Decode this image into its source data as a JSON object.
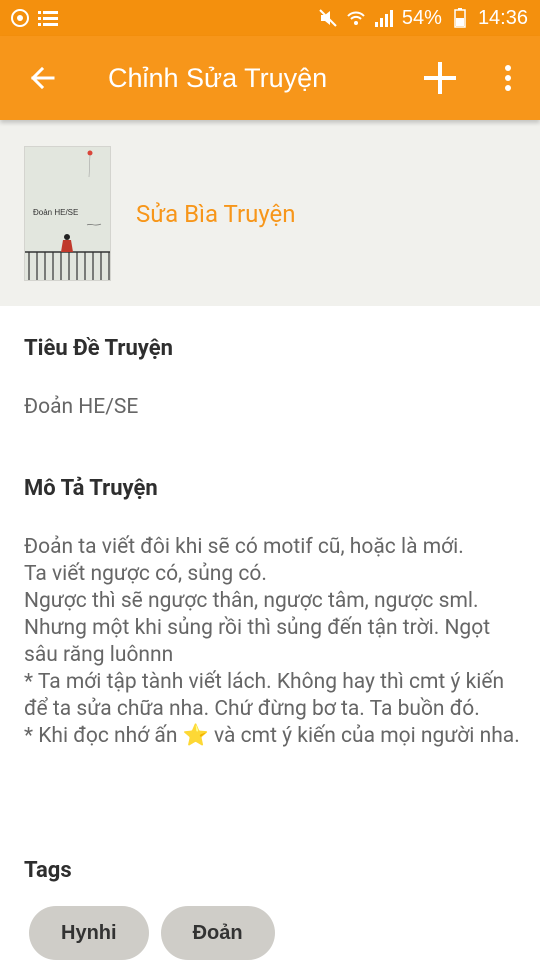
{
  "status_bar": {
    "battery_percent": "54%",
    "time": "14:36",
    "icons": [
      "app-notification-icon",
      "list-icon",
      "mute-icon",
      "wifi-icon",
      "signal-icon",
      "battery-icon"
    ]
  },
  "app_bar": {
    "title": "Chỉnh Sửa Truyện",
    "icons": [
      "back-arrow-icon",
      "add-icon",
      "more-vert-icon"
    ]
  },
  "cover": {
    "edit_label": "Sửa Bìa Truyện",
    "image_title": "Đoản HE/SE"
  },
  "story_title": {
    "label": "Tiêu Đề Truyện",
    "value": "Đoản HE/SE"
  },
  "story_description": {
    "label": "Mô Tả Truyện",
    "text_before_star": "Đoản ta viết đôi khi sẽ có motif cũ, hoặc là mới.\nTa viết ngược có, sủng có.\nNgược thì sẽ ngược thân, ngược tâm, ngược sml. Nhưng một khi sủng rồi thì sủng đến tận trời. Ngọt sâu răng luônnn\n* Ta mới tập tành viết lách. Không hay thì cmt ý kiến để ta sửa chữa nha. Chứ đừng bơ ta. Ta buồn đó.\n* Khi đọc nhớ ấn ",
    "star": "⭐",
    "text_after_star": " và cmt ý kiến của mọi người nha."
  },
  "tags_section": {
    "label": "Tags",
    "tags": [
      "Hynhi",
      "Đoản"
    ]
  },
  "colors": {
    "accent": "#f7961a",
    "status_bar": "#f4900d",
    "cover_bg": "#f1f1ed",
    "tag_bg": "#cfcdc8"
  }
}
